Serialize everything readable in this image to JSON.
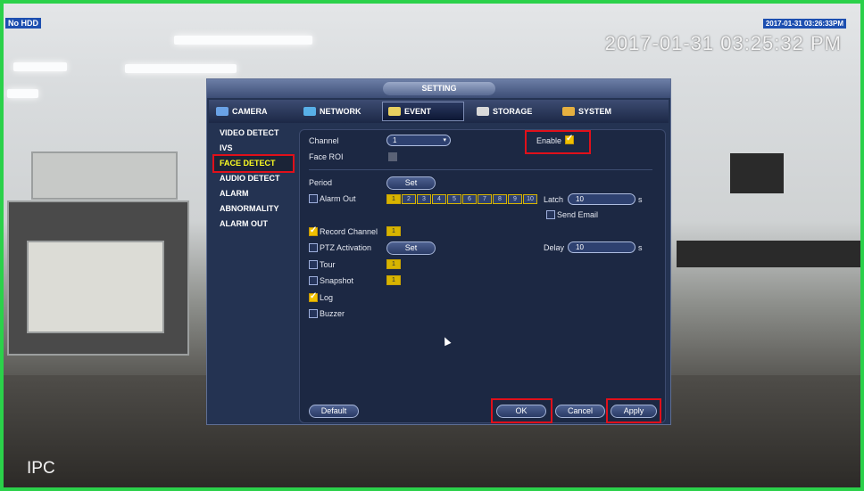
{
  "osd": {
    "hdd": "No HDD",
    "small_time": "2017-01-31 03:26:33PM",
    "time": "2017-01-31 03:25:32 PM",
    "channel_name": "IPC"
  },
  "dialog": {
    "title": "SETTING",
    "tabs": [
      {
        "label": "CAMERA",
        "icon": "camera-icon"
      },
      {
        "label": "NETWORK",
        "icon": "network-icon"
      },
      {
        "label": "EVENT",
        "icon": "event-icon",
        "active": true
      },
      {
        "label": "STORAGE",
        "icon": "storage-icon"
      },
      {
        "label": "SYSTEM",
        "icon": "system-icon"
      }
    ],
    "sidebar": [
      {
        "label": "VIDEO DETECT"
      },
      {
        "label": "IVS"
      },
      {
        "label": "FACE DETECT",
        "active": true
      },
      {
        "label": "AUDIO DETECT"
      },
      {
        "label": "ALARM"
      },
      {
        "label": "ABNORMALITY"
      },
      {
        "label": "ALARM OUT"
      }
    ],
    "form": {
      "channel_label": "Channel",
      "channel_value": "1",
      "enable_label": "Enable",
      "enable_checked": true,
      "face_roi_label": "Face ROI",
      "period_label": "Period",
      "set_label": "Set",
      "alarm_out_label": "Alarm Out",
      "alarm_out_channels": [
        "1",
        "2",
        "3",
        "4",
        "5",
        "6",
        "7",
        "8",
        "9",
        "10"
      ],
      "latch_label": "Latch",
      "latch_value": "10",
      "latch_unit": "s",
      "send_email_label": "Send Email",
      "record_channel_label": "Record Channel",
      "record_channel_value": "1",
      "ptz_label": "PTZ Activation",
      "delay_label": "Delay",
      "delay_value": "10",
      "delay_unit": "s",
      "tour_label": "Tour",
      "tour_value": "1",
      "snapshot_label": "Snapshot",
      "snapshot_value": "1",
      "log_label": "Log",
      "log_checked": true,
      "buzzer_label": "Buzzer"
    },
    "buttons": {
      "default": "Default",
      "ok": "OK",
      "cancel": "Cancel",
      "apply": "Apply"
    }
  },
  "colors": {
    "highlight_red": "#e0101a",
    "active_text_yellow": "#ffff22",
    "dialog_bg": "#243352",
    "frame_green": "#2bd14a"
  }
}
